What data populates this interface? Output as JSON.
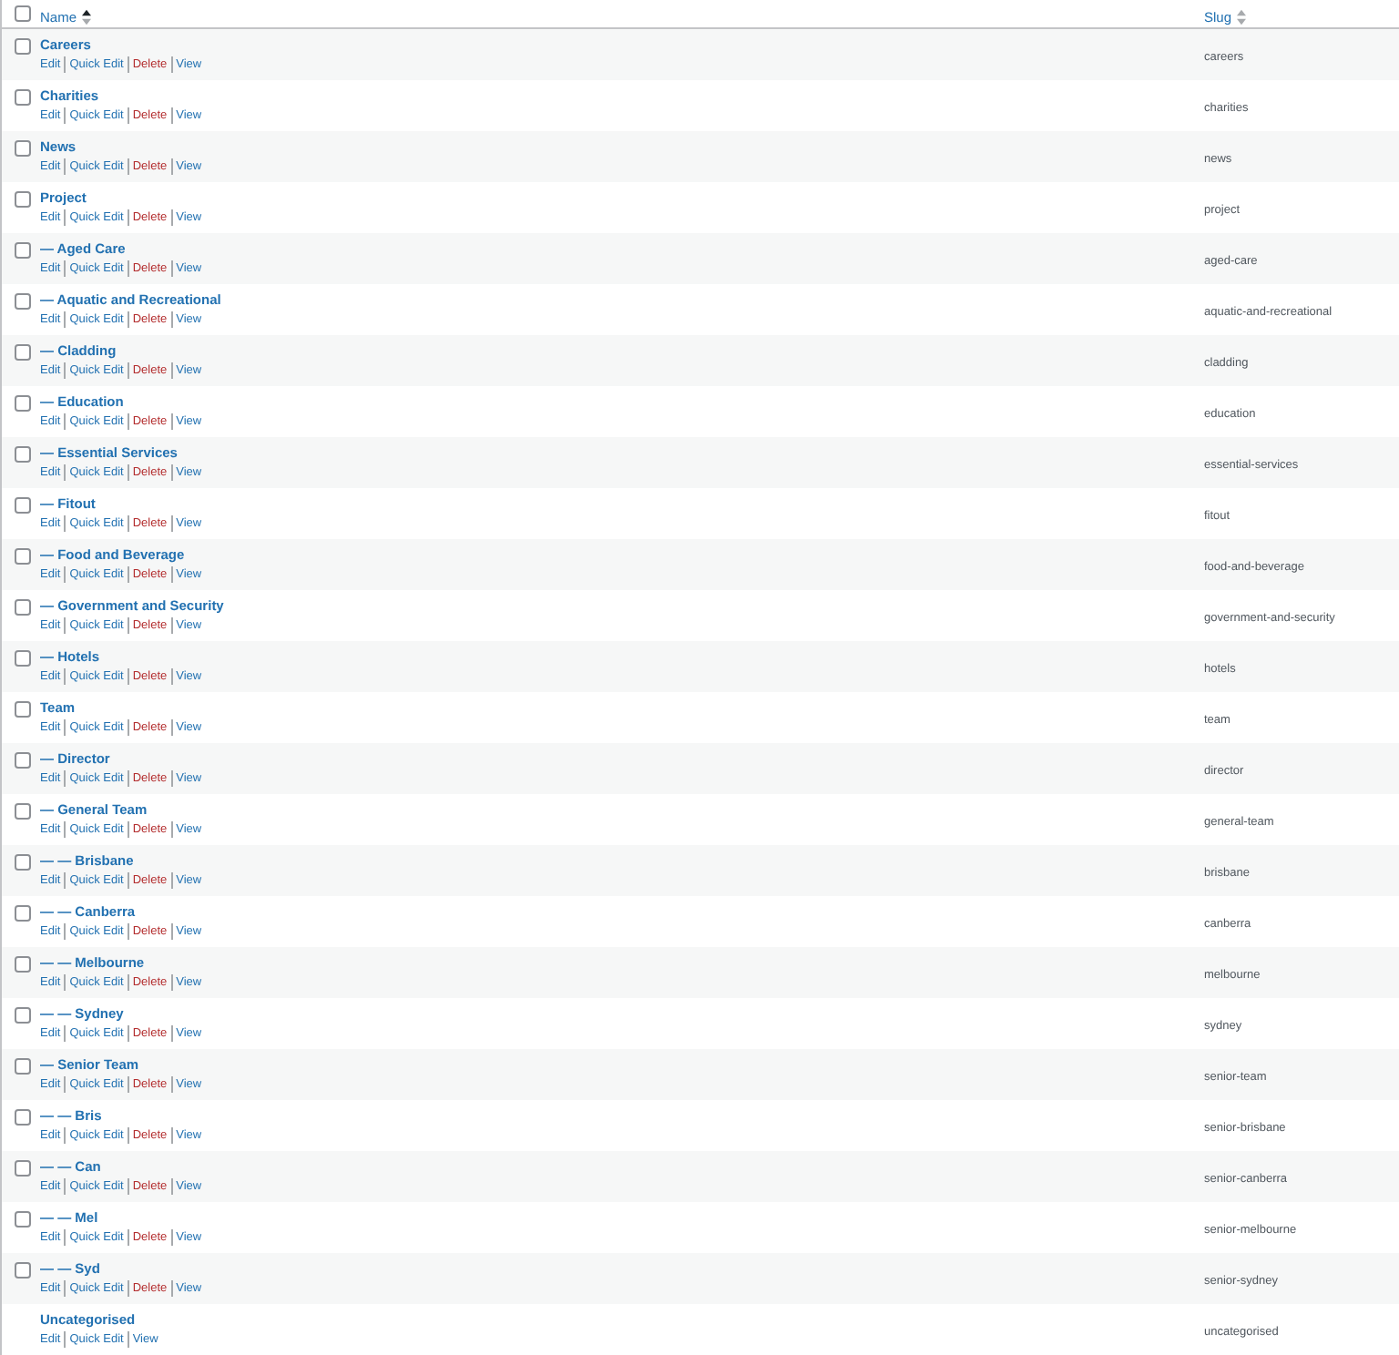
{
  "table": {
    "header_checkbox": {
      "checked": false
    },
    "columns": [
      {
        "label": "Name",
        "sorted": true
      },
      {
        "label": "Slug",
        "sorted": false
      }
    ],
    "rows": [
      {
        "name": "Careers",
        "slug": "careers",
        "checked": false,
        "actions": [
          {
            "kind": "edit",
            "label": "Edit"
          },
          {
            "kind": "quick_edit",
            "label": "Quick Edit"
          },
          {
            "kind": "delete",
            "label": "Delete"
          },
          {
            "kind": "view",
            "label": "View"
          }
        ]
      },
      {
        "name": "Charities",
        "slug": "charities",
        "checked": false,
        "actions": [
          {
            "kind": "edit",
            "label": "Edit"
          },
          {
            "kind": "quick_edit",
            "label": "Quick Edit"
          },
          {
            "kind": "delete",
            "label": "Delete"
          },
          {
            "kind": "view",
            "label": "View"
          }
        ]
      },
      {
        "name": "News",
        "slug": "news",
        "checked": false,
        "actions": [
          {
            "kind": "edit",
            "label": "Edit"
          },
          {
            "kind": "quick_edit",
            "label": "Quick Edit"
          },
          {
            "kind": "delete",
            "label": "Delete"
          },
          {
            "kind": "view",
            "label": "View"
          }
        ]
      },
      {
        "name": "Project",
        "slug": "project",
        "checked": false,
        "actions": [
          {
            "kind": "edit",
            "label": "Edit"
          },
          {
            "kind": "quick_edit",
            "label": "Quick Edit"
          },
          {
            "kind": "delete",
            "label": "Delete"
          },
          {
            "kind": "view",
            "label": "View"
          }
        ]
      },
      {
        "name": "— Aged Care",
        "slug": "aged-care",
        "checked": false,
        "actions": [
          {
            "kind": "edit",
            "label": "Edit"
          },
          {
            "kind": "quick_edit",
            "label": "Quick Edit"
          },
          {
            "kind": "delete",
            "label": "Delete"
          },
          {
            "kind": "view",
            "label": "View"
          }
        ]
      },
      {
        "name": "— Aquatic and Recreational",
        "slug": "aquatic-and-recreational",
        "checked": false,
        "actions": [
          {
            "kind": "edit",
            "label": "Edit"
          },
          {
            "kind": "quick_edit",
            "label": "Quick Edit"
          },
          {
            "kind": "delete",
            "label": "Delete"
          },
          {
            "kind": "view",
            "label": "View"
          }
        ]
      },
      {
        "name": "— Cladding",
        "slug": "cladding",
        "checked": false,
        "actions": [
          {
            "kind": "edit",
            "label": "Edit"
          },
          {
            "kind": "quick_edit",
            "label": "Quick Edit"
          },
          {
            "kind": "delete",
            "label": "Delete"
          },
          {
            "kind": "view",
            "label": "View"
          }
        ]
      },
      {
        "name": "— Education",
        "slug": "education",
        "checked": false,
        "actions": [
          {
            "kind": "edit",
            "label": "Edit"
          },
          {
            "kind": "quick_edit",
            "label": "Quick Edit"
          },
          {
            "kind": "delete",
            "label": "Delete"
          },
          {
            "kind": "view",
            "label": "View"
          }
        ]
      },
      {
        "name": "— Essential Services",
        "slug": "essential-services",
        "checked": false,
        "actions": [
          {
            "kind": "edit",
            "label": "Edit"
          },
          {
            "kind": "quick_edit",
            "label": "Quick Edit"
          },
          {
            "kind": "delete",
            "label": "Delete"
          },
          {
            "kind": "view",
            "label": "View"
          }
        ]
      },
      {
        "name": "— Fitout",
        "slug": "fitout",
        "checked": false,
        "actions": [
          {
            "kind": "edit",
            "label": "Edit"
          },
          {
            "kind": "quick_edit",
            "label": "Quick Edit"
          },
          {
            "kind": "delete",
            "label": "Delete"
          },
          {
            "kind": "view",
            "label": "View"
          }
        ]
      },
      {
        "name": "— Food and Beverage",
        "slug": "food-and-beverage",
        "checked": false,
        "actions": [
          {
            "kind": "edit",
            "label": "Edit"
          },
          {
            "kind": "quick_edit",
            "label": "Quick Edit"
          },
          {
            "kind": "delete",
            "label": "Delete"
          },
          {
            "kind": "view",
            "label": "View"
          }
        ]
      },
      {
        "name": "— Government and Security",
        "slug": "government-and-security",
        "checked": false,
        "actions": [
          {
            "kind": "edit",
            "label": "Edit"
          },
          {
            "kind": "quick_edit",
            "label": "Quick Edit"
          },
          {
            "kind": "delete",
            "label": "Delete"
          },
          {
            "kind": "view",
            "label": "View"
          }
        ]
      },
      {
        "name": "— Hotels",
        "slug": "hotels",
        "checked": false,
        "actions": [
          {
            "kind": "edit",
            "label": "Edit"
          },
          {
            "kind": "quick_edit",
            "label": "Quick Edit"
          },
          {
            "kind": "delete",
            "label": "Delete"
          },
          {
            "kind": "view",
            "label": "View"
          }
        ]
      },
      {
        "name": "Team",
        "slug": "team",
        "checked": false,
        "actions": [
          {
            "kind": "edit",
            "label": "Edit"
          },
          {
            "kind": "quick_edit",
            "label": "Quick Edit"
          },
          {
            "kind": "delete",
            "label": "Delete"
          },
          {
            "kind": "view",
            "label": "View"
          }
        ]
      },
      {
        "name": "— Director",
        "slug": "director",
        "checked": false,
        "actions": [
          {
            "kind": "edit",
            "label": "Edit"
          },
          {
            "kind": "quick_edit",
            "label": "Quick Edit"
          },
          {
            "kind": "delete",
            "label": "Delete"
          },
          {
            "kind": "view",
            "label": "View"
          }
        ]
      },
      {
        "name": "— General Team",
        "slug": "general-team",
        "checked": false,
        "actions": [
          {
            "kind": "edit",
            "label": "Edit"
          },
          {
            "kind": "quick_edit",
            "label": "Quick Edit"
          },
          {
            "kind": "delete",
            "label": "Delete"
          },
          {
            "kind": "view",
            "label": "View"
          }
        ]
      },
      {
        "name": "— — Brisbane",
        "slug": "brisbane",
        "checked": false,
        "actions": [
          {
            "kind": "edit",
            "label": "Edit"
          },
          {
            "kind": "quick_edit",
            "label": "Quick Edit"
          },
          {
            "kind": "delete",
            "label": "Delete"
          },
          {
            "kind": "view",
            "label": "View"
          }
        ]
      },
      {
        "name": "— — Canberra",
        "slug": "canberra",
        "checked": false,
        "actions": [
          {
            "kind": "edit",
            "label": "Edit"
          },
          {
            "kind": "quick_edit",
            "label": "Quick Edit"
          },
          {
            "kind": "delete",
            "label": "Delete"
          },
          {
            "kind": "view",
            "label": "View"
          }
        ]
      },
      {
        "name": "— — Melbourne",
        "slug": "melbourne",
        "checked": false,
        "actions": [
          {
            "kind": "edit",
            "label": "Edit"
          },
          {
            "kind": "quick_edit",
            "label": "Quick Edit"
          },
          {
            "kind": "delete",
            "label": "Delete"
          },
          {
            "kind": "view",
            "label": "View"
          }
        ]
      },
      {
        "name": "— — Sydney",
        "slug": "sydney",
        "checked": false,
        "actions": [
          {
            "kind": "edit",
            "label": "Edit"
          },
          {
            "kind": "quick_edit",
            "label": "Quick Edit"
          },
          {
            "kind": "delete",
            "label": "Delete"
          },
          {
            "kind": "view",
            "label": "View"
          }
        ]
      },
      {
        "name": "— Senior Team",
        "slug": "senior-team",
        "checked": false,
        "actions": [
          {
            "kind": "edit",
            "label": "Edit"
          },
          {
            "kind": "quick_edit",
            "label": "Quick Edit"
          },
          {
            "kind": "delete",
            "label": "Delete"
          },
          {
            "kind": "view",
            "label": "View"
          }
        ]
      },
      {
        "name": "— — Bris",
        "slug": "senior-brisbane",
        "checked": false,
        "actions": [
          {
            "kind": "edit",
            "label": "Edit"
          },
          {
            "kind": "quick_edit",
            "label": "Quick Edit"
          },
          {
            "kind": "delete",
            "label": "Delete"
          },
          {
            "kind": "view",
            "label": "View"
          }
        ]
      },
      {
        "name": "— — Can",
        "slug": "senior-canberra",
        "checked": false,
        "actions": [
          {
            "kind": "edit",
            "label": "Edit"
          },
          {
            "kind": "quick_edit",
            "label": "Quick Edit"
          },
          {
            "kind": "delete",
            "label": "Delete"
          },
          {
            "kind": "view",
            "label": "View"
          }
        ]
      },
      {
        "name": "— — Mel",
        "slug": "senior-melbourne",
        "checked": false,
        "actions": [
          {
            "kind": "edit",
            "label": "Edit"
          },
          {
            "kind": "quick_edit",
            "label": "Quick Edit"
          },
          {
            "kind": "delete",
            "label": "Delete"
          },
          {
            "kind": "view",
            "label": "View"
          }
        ]
      },
      {
        "name": "— — Syd",
        "slug": "senior-sydney",
        "checked": false,
        "actions": [
          {
            "kind": "edit",
            "label": "Edit"
          },
          {
            "kind": "quick_edit",
            "label": "Quick Edit"
          },
          {
            "kind": "delete",
            "label": "Delete"
          },
          {
            "kind": "view",
            "label": "View"
          }
        ]
      },
      {
        "name": "Uncategorised",
        "slug": "uncategorised",
        "actions": [
          {
            "kind": "edit",
            "label": "Edit"
          },
          {
            "kind": "quick_edit",
            "label": "Quick Edit"
          },
          {
            "kind": "view",
            "label": "View"
          }
        ]
      }
    ]
  }
}
